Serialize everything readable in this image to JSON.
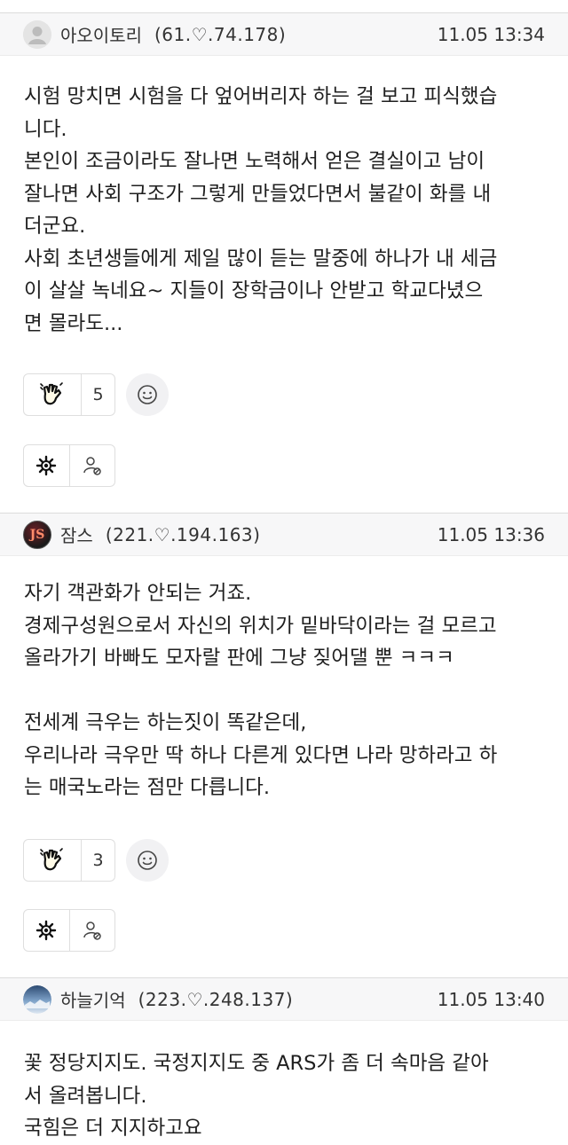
{
  "comments": [
    {
      "author": "아오이토리",
      "ip": "(61.♡.74.178)",
      "time": "11.05 13:34",
      "avatar": "default-user-avatar",
      "lines": [
        "시험 망치면 시험을 다 엎어버리자 하는 걸 보고 피식했습",
        "니다.",
        "본인이 조금이라도 잘나면 노력해서 얻은 결실이고 남이",
        "잘나면 사회 구조가 그렇게 만들었다면서 불같이 화를 내",
        "더군요.",
        "사회 초년생들에게 제일 많이 듣는 말중에 하나가 내 세금",
        "이 살살 녹네요~ 지들이 장학금이나 안받고 학교다녔으",
        "면 몰라도..."
      ],
      "likes": "5"
    },
    {
      "author": "잠스",
      "ip": "(221.♡.194.163)",
      "time": "11.05 13:36",
      "avatar": "js-logo-avatar",
      "avatar_text": "JS",
      "lines": [
        "자기 객관화가 안되는 거죠.",
        "경제구성원으로서 자신의 위치가 밑바닥이라는 걸 모르고",
        "올라가기 바빠도 모자랄 판에 그냥 짖어댈 뿐 ㅋㅋㅋ",
        "",
        "전세계 극우는 하는짓이 똑같은데,",
        "우리나라 극우만 딱 하나 다른게 있다면 나라 망하라고 하",
        "는 매국노라는 점만 다릅니다."
      ],
      "likes": "3"
    },
    {
      "author": "하늘기억",
      "ip": "(223.♡.248.137)",
      "time": "11.05 13:40",
      "avatar": "sky-photo-avatar",
      "lines": [
        "꽃 정당지지도. 국정지지도 중 ARS가 좀 더 속마음 같아",
        "서 올려봅니다.",
        "국힘은 더 지지하고요"
      ]
    }
  ],
  "icons": {
    "like": "clapping-hand-icon",
    "emoji": "smiley-icon",
    "tool_a": "gear-burst-icon",
    "tool_b": "user-block-icon"
  },
  "colors": {
    "header_bg": "#f7f7f8",
    "border": "#dedede",
    "text": "#1f1f1f"
  }
}
